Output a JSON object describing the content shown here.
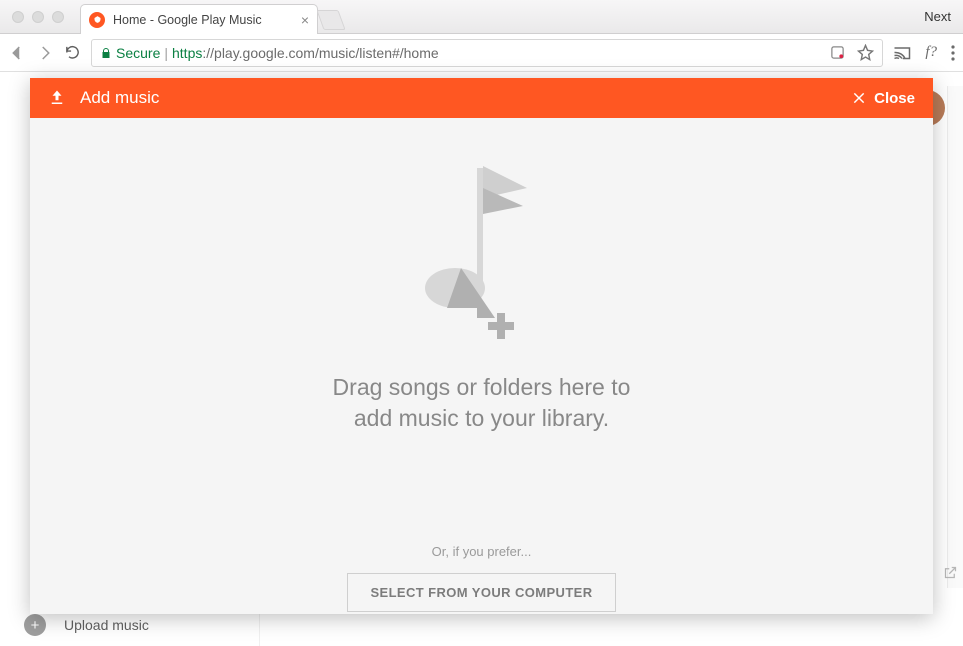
{
  "browser": {
    "window_controls": {
      "next_label": "Next"
    },
    "tab": {
      "title": "Home - Google Play Music"
    },
    "address_bar": {
      "secure_label": "Secure",
      "scheme": "https",
      "host": "://play.google.com",
      "path": "/music/listen#/home"
    },
    "toolbar_icons": {
      "back": "back-icon",
      "forward": "forward-icon",
      "reload": "reload-icon",
      "extension": "extension-icon",
      "star": "star-icon",
      "cast": "cast-icon",
      "fquery": "f?",
      "menu": "menu-icon"
    }
  },
  "page": {
    "sidebar": {
      "upload_label": "Upload music"
    }
  },
  "modal": {
    "header": {
      "title": "Add music",
      "close_label": "Close"
    },
    "body": {
      "drag_line1": "Drag songs or folders here to",
      "drag_line2": "add music to your library.",
      "or_prefer": "Or, if you prefer...",
      "select_button": "SELECT FROM YOUR COMPUTER"
    }
  },
  "colors": {
    "accent": "#ff5722"
  }
}
